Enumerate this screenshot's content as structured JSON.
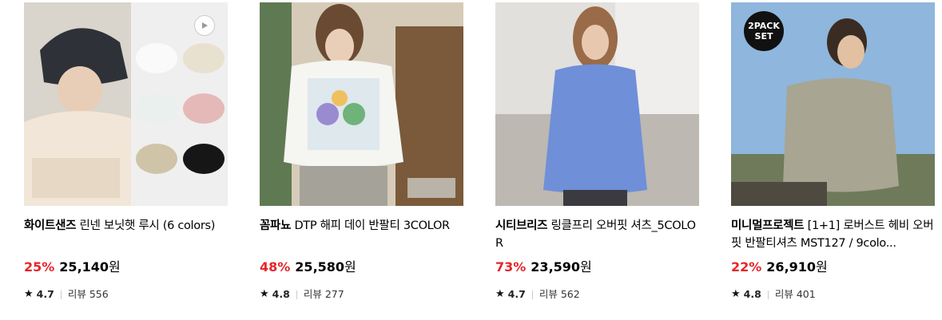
{
  "products": [
    {
      "brand": "화이트샌즈",
      "name": "린넨 보닛햇 루시 (6 colors)",
      "discount": "25%",
      "price": "25,140",
      "currency": "원",
      "rating": "4.7",
      "review_label": "리뷰",
      "reviews": "556"
    },
    {
      "brand": "꼼파뇨",
      "name": "DTP 해피 데이 반팔티 3COLOR",
      "discount": "48%",
      "price": "25,580",
      "currency": "원",
      "rating": "4.8",
      "review_label": "리뷰",
      "reviews": "277"
    },
    {
      "brand": "시티브리즈",
      "name": "링클프리 오버핏 셔츠_5COLOR",
      "discount": "73%",
      "price": "23,590",
      "currency": "원",
      "rating": "4.7",
      "review_label": "리뷰",
      "reviews": "562"
    },
    {
      "brand": "미니멀프로젝트",
      "name": "[1+1] 로버스트 헤비 오버핏 반팔티셔츠 MST127 / 9colo...",
      "discount": "22%",
      "price": "26,910",
      "currency": "원",
      "rating": "4.8",
      "review_label": "리뷰",
      "reviews": "401",
      "badge": [
        "2PACK",
        "SET"
      ]
    }
  ],
  "colors": {
    "discount": "#e5252a"
  }
}
